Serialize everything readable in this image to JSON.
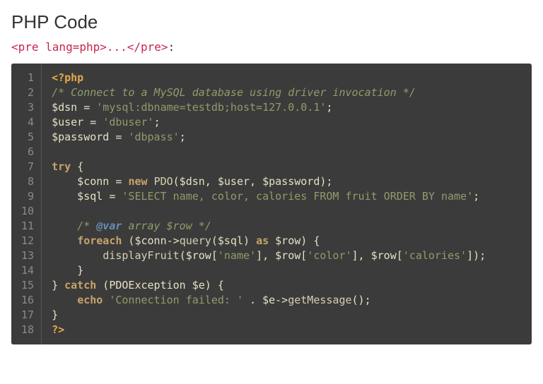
{
  "heading": "PHP Code",
  "pre_tag_text": "<pre lang=php>...</pre>",
  "pre_tag_colon": ":",
  "code": {
    "line_numbers": [
      "1",
      "2",
      "3",
      "4",
      "5",
      "6",
      "7",
      "8",
      "9",
      "10",
      "11",
      "12",
      "13",
      "14",
      "15",
      "16",
      "17",
      "18"
    ],
    "lines": [
      [
        {
          "c": "t-tag",
          "t": "<?php"
        }
      ],
      [
        {
          "c": "t-comment",
          "t": "/* Connect to a MySQL database using driver invocation */"
        }
      ],
      [
        {
          "c": "t-plain",
          "t": "$dsn = "
        },
        {
          "c": "t-string",
          "t": "'mysql:dbname=testdb;host=127.0.0.1'"
        },
        {
          "c": "t-punct",
          "t": ";"
        }
      ],
      [
        {
          "c": "t-plain",
          "t": "$user = "
        },
        {
          "c": "t-string",
          "t": "'dbuser'"
        },
        {
          "c": "t-punct",
          "t": ";"
        }
      ],
      [
        {
          "c": "t-plain",
          "t": "$password = "
        },
        {
          "c": "t-string",
          "t": "'dbpass'"
        },
        {
          "c": "t-punct",
          "t": ";"
        }
      ],
      [
        {
          "c": "t-plain",
          "t": ""
        }
      ],
      [
        {
          "c": "t-keyword",
          "t": "try"
        },
        {
          "c": "t-punct",
          "t": " {"
        }
      ],
      [
        {
          "c": "t-plain",
          "t": "    $conn = "
        },
        {
          "c": "t-keyword",
          "t": "new"
        },
        {
          "c": "t-plain",
          "t": " "
        },
        {
          "c": "t-type",
          "t": "PDO"
        },
        {
          "c": "t-plain",
          "t": "($dsn, $user, $password);"
        }
      ],
      [
        {
          "c": "t-plain",
          "t": "    $sql = "
        },
        {
          "c": "t-string",
          "t": "'SELECT name, color, calories FROM fruit ORDER BY name'"
        },
        {
          "c": "t-punct",
          "t": ";"
        }
      ],
      [
        {
          "c": "t-plain",
          "t": ""
        }
      ],
      [
        {
          "c": "t-plain",
          "t": "    "
        },
        {
          "c": "t-comment",
          "t": "/* "
        },
        {
          "c": "t-doctag",
          "t": "@var"
        },
        {
          "c": "t-comment",
          "t": " array $row */"
        }
      ],
      [
        {
          "c": "t-plain",
          "t": "    "
        },
        {
          "c": "t-keyword",
          "t": "foreach"
        },
        {
          "c": "t-plain",
          "t": " ($conn->"
        },
        {
          "c": "t-func",
          "t": "query"
        },
        {
          "c": "t-plain",
          "t": "($sql) "
        },
        {
          "c": "t-keyword",
          "t": "as"
        },
        {
          "c": "t-plain",
          "t": " $row) {"
        }
      ],
      [
        {
          "c": "t-plain",
          "t": "        "
        },
        {
          "c": "t-func",
          "t": "displayFruit"
        },
        {
          "c": "t-plain",
          "t": "($row["
        },
        {
          "c": "t-string",
          "t": "'name'"
        },
        {
          "c": "t-plain",
          "t": "], $row["
        },
        {
          "c": "t-string",
          "t": "'color'"
        },
        {
          "c": "t-plain",
          "t": "], $row["
        },
        {
          "c": "t-string",
          "t": "'calories'"
        },
        {
          "c": "t-plain",
          "t": "]);"
        }
      ],
      [
        {
          "c": "t-plain",
          "t": "    }"
        }
      ],
      [
        {
          "c": "t-punct",
          "t": "} "
        },
        {
          "c": "t-keyword",
          "t": "catch"
        },
        {
          "c": "t-plain",
          "t": " (PDOException $e) {"
        }
      ],
      [
        {
          "c": "t-plain",
          "t": "    "
        },
        {
          "c": "t-keyword",
          "t": "echo"
        },
        {
          "c": "t-plain",
          "t": " "
        },
        {
          "c": "t-string",
          "t": "'Connection failed: '"
        },
        {
          "c": "t-plain",
          "t": " . $e->"
        },
        {
          "c": "t-func",
          "t": "getMessage"
        },
        {
          "c": "t-plain",
          "t": "();"
        }
      ],
      [
        {
          "c": "t-punct",
          "t": "}"
        }
      ],
      [
        {
          "c": "t-tag",
          "t": "?>"
        }
      ]
    ]
  }
}
